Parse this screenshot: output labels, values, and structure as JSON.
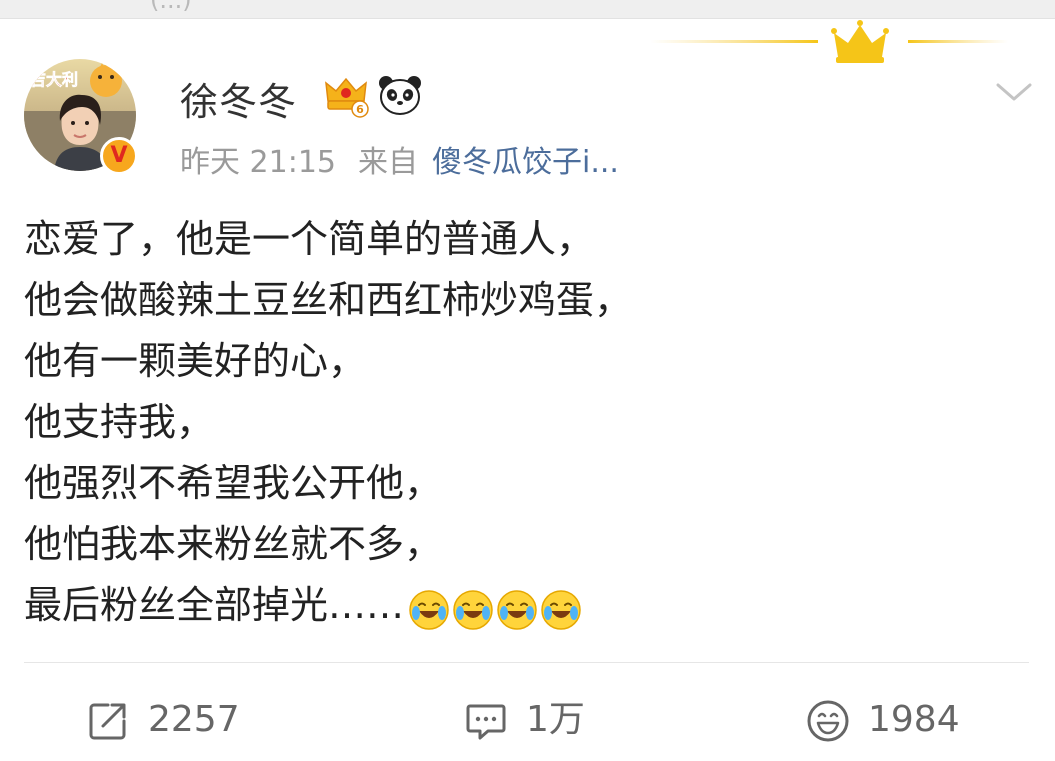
{
  "top_strip": {
    "partial_text": "(...)"
  },
  "post": {
    "author": "徐冬冬",
    "vip_level": "6",
    "verified_badge": "V",
    "avatar_sticker_text": "吉大利",
    "time": "昨天 21:15",
    "source_prefix": "来自",
    "source": "傻冬瓜饺子i...",
    "lines": [
      "恋爱了，他是一个简单的普通人，",
      "他会做酸辣土豆丝和西红柿炒鸡蛋，",
      "他有一颗美好的心，",
      "他支持我，",
      "他强烈不希望我公开他，",
      "他怕我本来粉丝就不多，",
      "最后粉丝全部掉光……"
    ],
    "trailing_emoji": [
      "laugh-cry-emoji",
      "laugh-cry-emoji",
      "laugh-cry-emoji",
      "laugh-cry-emoji"
    ]
  },
  "actions": {
    "repost": {
      "icon": "share-icon",
      "count": "2257"
    },
    "comment": {
      "icon": "comment-icon",
      "count": "1万"
    },
    "like": {
      "icon": "smile-icon",
      "count": "1984"
    }
  },
  "colors": {
    "text": "#222222",
    "meta": "#9a9a9a",
    "link": "#4c6d9b",
    "gold": "#f5c518",
    "divider": "#e6e6e6"
  }
}
